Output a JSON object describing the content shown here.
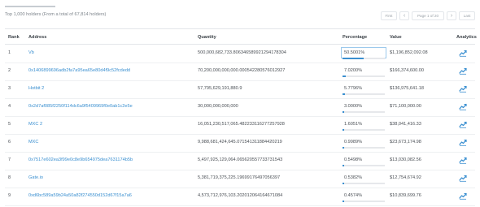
{
  "summary": "Top 1,000 holders (From a total of 67,814 holders)",
  "pager": {
    "first": "First",
    "prev_arrow": "‹",
    "page_label": "Page 1 of 20",
    "next_arrow": "›",
    "last": "Last"
  },
  "columns": {
    "rank": "Rank",
    "address": "Address",
    "quantity": "Quantity",
    "percentage": "Percentage",
    "value": "Value",
    "analytics": "Analytics"
  },
  "accent_color": "#3a8fd0",
  "rows": [
    {
      "rank": "1",
      "address": "Vb",
      "quantity": "500,000,682,733.806346589921294178304",
      "percentage": "50.5001%",
      "pct_value": 50.5001,
      "value": "$1,196,852,092.08"
    },
    {
      "rank": "2",
      "address": "0x1406899696adb2fa7a95ea65e80d4f9c52fcdedd",
      "quantity": "70,200,000,000,000.000542280576012927",
      "percentage": "7.0200%",
      "pct_value": 7.02,
      "value": "$166,374,600.00"
    },
    {
      "rank": "3",
      "address": "Hotbit 2",
      "quantity": "57,795,629,191,880.9",
      "percentage": "5.7796%",
      "pct_value": 5.7796,
      "value": "$136,975,641.18"
    },
    {
      "rank": "4",
      "address": "0x2d7af085f2250f114dc6a9f5409969f0e0ab1c2e5e",
      "quantity": "30,000,000,000,000",
      "percentage": "3.0000%",
      "pct_value": 3.0,
      "value": "$71,100,000.00"
    },
    {
      "rank": "5",
      "address": "MXC 2",
      "quantity": "16,051,230,517,065.482233116277257928",
      "percentage": "1.6051%",
      "pct_value": 1.6051,
      "value": "$38,041,416.33"
    },
    {
      "rank": "6",
      "address": "MXC",
      "quantity": "9,988,681,424,645.071541311884420219",
      "percentage": "0.9989%",
      "pct_value": 0.9989,
      "value": "$23,673,174.98"
    },
    {
      "rank": "7",
      "address": "0x7517e602ea3f99e0c8e9b654975dea7631174b5b",
      "quantity": "5,497,925,129,064.065620557733731543",
      "percentage": "0.5498%",
      "pct_value": 0.5498,
      "value": "$13,030,082.56"
    },
    {
      "rank": "8",
      "address": "Gate.io",
      "quantity": "5,381,719,375,225.19699176497056397",
      "percentage": "0.5382%",
      "pct_value": 0.5382,
      "value": "$12,754,674.92"
    },
    {
      "rank": "9",
      "address": "0xd6bc589a59b24a50a82f274550d152d67f15a7a6",
      "quantity": "4,573,712,976,103.202012064164671084",
      "percentage": "0.4574%",
      "pct_value": 0.4574,
      "value": "$10,839,699.76"
    }
  ]
}
